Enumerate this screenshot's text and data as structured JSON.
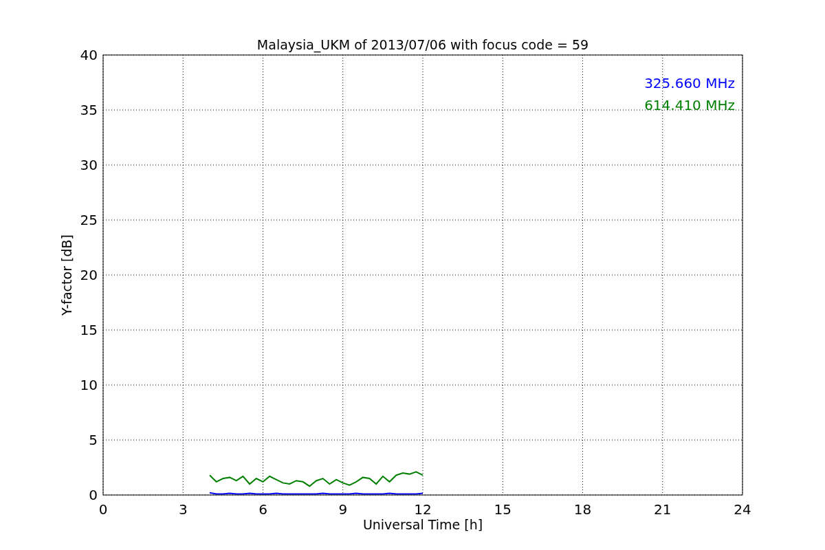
{
  "figure": {
    "chart_data": {
      "type": "line",
      "title": "Malaysia_UKM of 2013/07/06 with focus code = 59",
      "xlabel": "Universal Time [h]",
      "ylabel": "Y-factor [dB]",
      "x": [
        4,
        4.25,
        4.5,
        4.75,
        5,
        5.25,
        5.5,
        5.75,
        6,
        6.25,
        6.5,
        6.75,
        7,
        7.25,
        7.5,
        7.75,
        8,
        8.25,
        8.5,
        8.75,
        9,
        9.25,
        9.5,
        9.75,
        10,
        10.25,
        10.5,
        10.75,
        11,
        11.25,
        11.5,
        11.75,
        12
      ],
      "series": [
        {
          "name": "325.660 MHz",
          "color": "#0000ff",
          "values": [
            0.2,
            0.1,
            0.1,
            0.15,
            0.1,
            0.1,
            0.15,
            0.1,
            0.1,
            0.1,
            0.15,
            0.1,
            0.1,
            0.1,
            0.1,
            0.1,
            0.1,
            0.15,
            0.1,
            0.1,
            0.1,
            0.1,
            0.15,
            0.1,
            0.1,
            0.1,
            0.1,
            0.15,
            0.1,
            0.1,
            0.1,
            0.1,
            0.15
          ]
        },
        {
          "name": "614.410 MHz",
          "color": "#008000",
          "values": [
            1.8,
            1.2,
            1.5,
            1.6,
            1.3,
            1.7,
            1.0,
            1.5,
            1.2,
            1.7,
            1.4,
            1.1,
            1.0,
            1.3,
            1.2,
            0.8,
            1.3,
            1.5,
            1.0,
            1.4,
            1.1,
            0.9,
            1.2,
            1.6,
            1.5,
            1.0,
            1.7,
            1.2,
            1.8,
            2.0,
            1.9,
            2.1,
            1.8
          ]
        }
      ],
      "xlim": [
        0,
        24
      ],
      "ylim": [
        0,
        40
      ],
      "xticks": [
        0,
        3,
        6,
        9,
        12,
        15,
        18,
        21,
        24
      ],
      "yticks": [
        0,
        5,
        10,
        15,
        20,
        25,
        30,
        35,
        40
      ],
      "grid": true
    }
  }
}
